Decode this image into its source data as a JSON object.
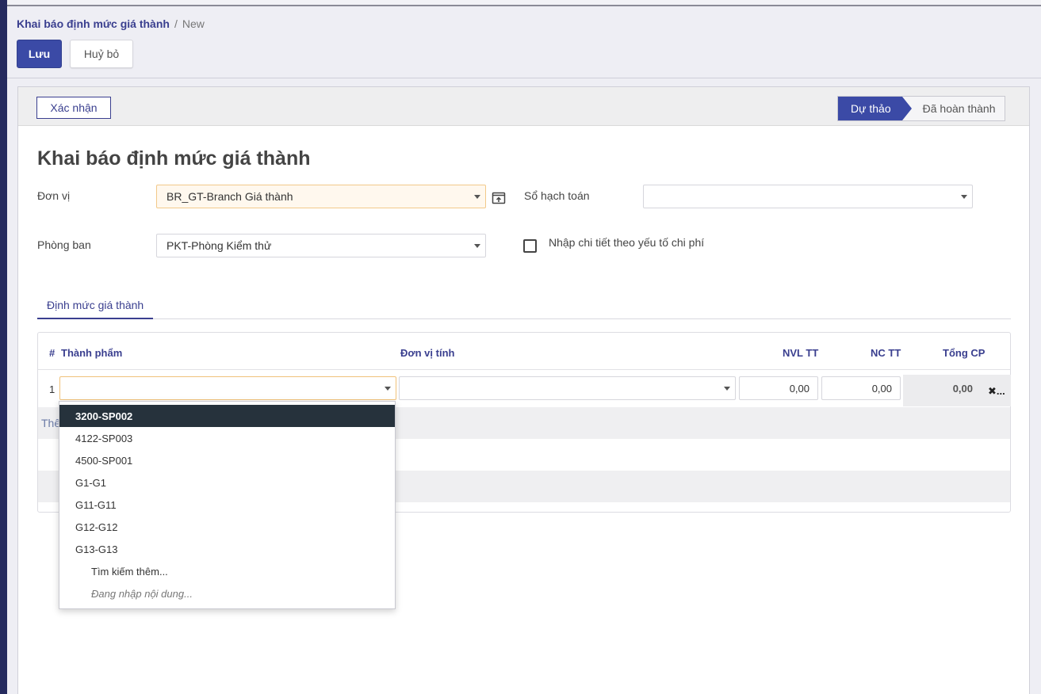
{
  "breadcrumb": {
    "parent": "Khai báo định mức giá thành",
    "separator": "/",
    "current": "New"
  },
  "toolbar": {
    "save_label": "Lưu",
    "discard_label": "Huỷ bỏ"
  },
  "statusbar": {
    "confirm_label": "Xác nhận",
    "stages": [
      "Dự thảo",
      "Đã hoàn thành"
    ],
    "active_stage": "Dự thảo"
  },
  "form": {
    "title": "Khai báo định mức giá thành",
    "don_vi": {
      "label": "Đơn vị",
      "value": "BR_GT-Branch Giá thành"
    },
    "so_hach_toan": {
      "label": "Sổ hạch toán",
      "value": ""
    },
    "phong_ban": {
      "label": "Phòng ban",
      "value": "PKT-Phòng Kiểm thử"
    },
    "chi_tiet": {
      "label": "Nhập chi tiết theo yếu tố chi phí",
      "checked": false
    }
  },
  "tabs": [
    {
      "label": "Định mức giá thành",
      "active": true
    }
  ],
  "grid": {
    "columns": [
      "#",
      "Thành phẩm",
      "Đơn vị tính",
      "NVL TT",
      "NC TT",
      "Tổng CP"
    ],
    "rows": [
      {
        "index": "1",
        "thanh_pham": "",
        "don_vi_tinh": "",
        "nvl_tt": "0,00",
        "nc_tt": "0,00",
        "tong_cp": "0,00"
      }
    ],
    "add_line_visible": "Thê",
    "delete_label": "✖..."
  },
  "dropdown": {
    "options": [
      "3200-SP002",
      "4122-SP003",
      "4500-SP001",
      "G1-G1",
      "G11-G11",
      "G12-G12",
      "G13-G13"
    ],
    "highlighted": "3200-SP002",
    "search_more": "Tìm kiếm thêm...",
    "loading": "Đang nhập nội dung..."
  },
  "colors": {
    "primary": "#3b4aa6",
    "sidebar": "#252a5e",
    "highlight": "#26323c"
  },
  "icons": {
    "external_link": "external-link-icon",
    "caret": "caret-down-icon"
  }
}
